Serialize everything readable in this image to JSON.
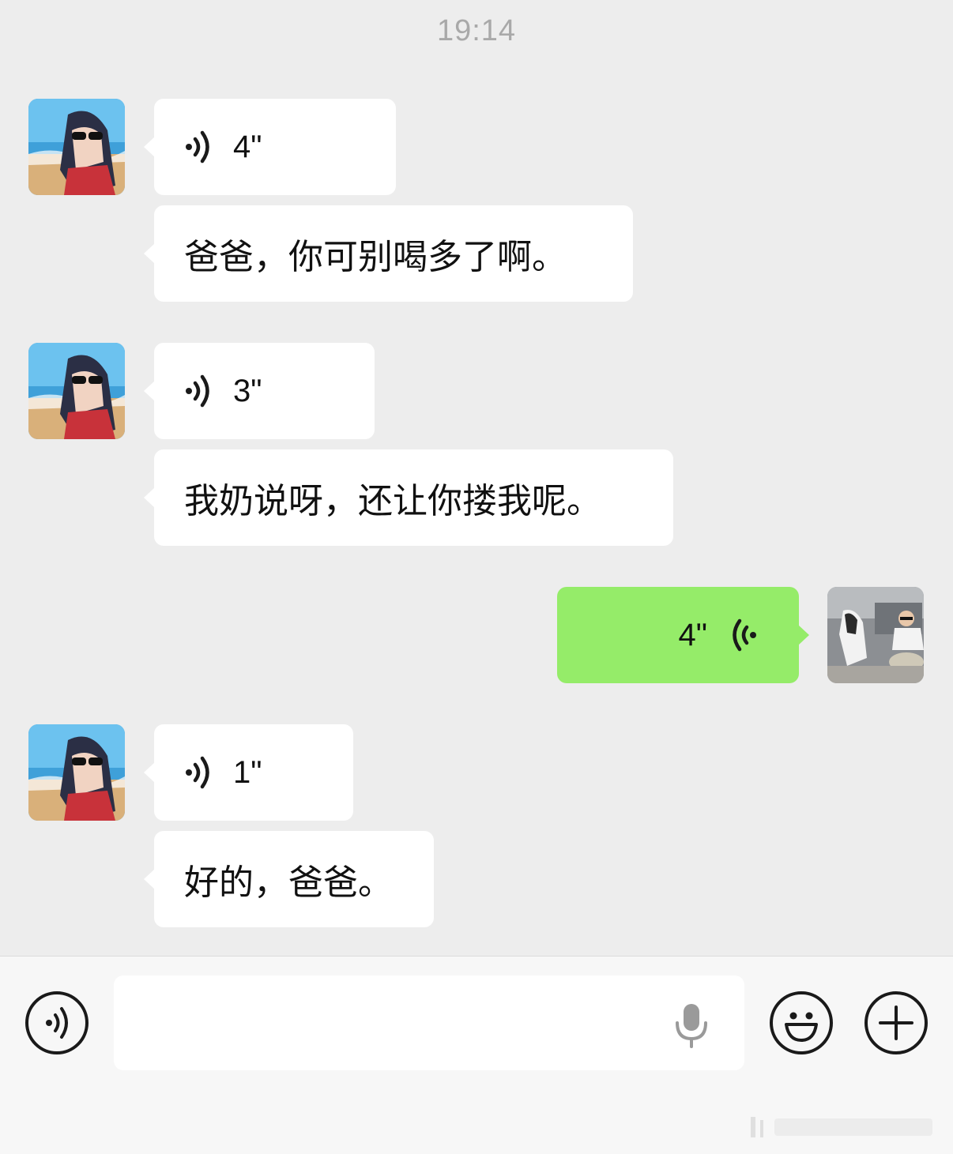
{
  "header": {
    "time": "19:14"
  },
  "messages": [
    {
      "sender": "other",
      "type": "voice",
      "duration": "4\""
    },
    {
      "sender": "other",
      "type": "text",
      "text": "爸爸，你可别喝多了啊。"
    },
    {
      "sender": "other",
      "type": "voice",
      "duration": "3\""
    },
    {
      "sender": "other",
      "type": "text",
      "text": "我奶说呀，还让你搂我呢。"
    },
    {
      "sender": "me",
      "type": "voice",
      "duration": "4\""
    },
    {
      "sender": "other",
      "type": "voice",
      "duration": "1\""
    },
    {
      "sender": "other",
      "type": "text",
      "text": "好的，爸爸。"
    }
  ],
  "input_bar": {
    "left_icon": "voice-mode-icon",
    "input_value": "",
    "mic_icon": "microphone-icon",
    "emoji_icon": "emoji-icon",
    "plus_icon": "plus-icon"
  },
  "colors": {
    "background": "#ededed",
    "incoming_bubble": "#ffffff",
    "outgoing_bubble": "#95ec69",
    "timestamp": "#a9a9a9",
    "input_bar": "#f7f7f7"
  }
}
